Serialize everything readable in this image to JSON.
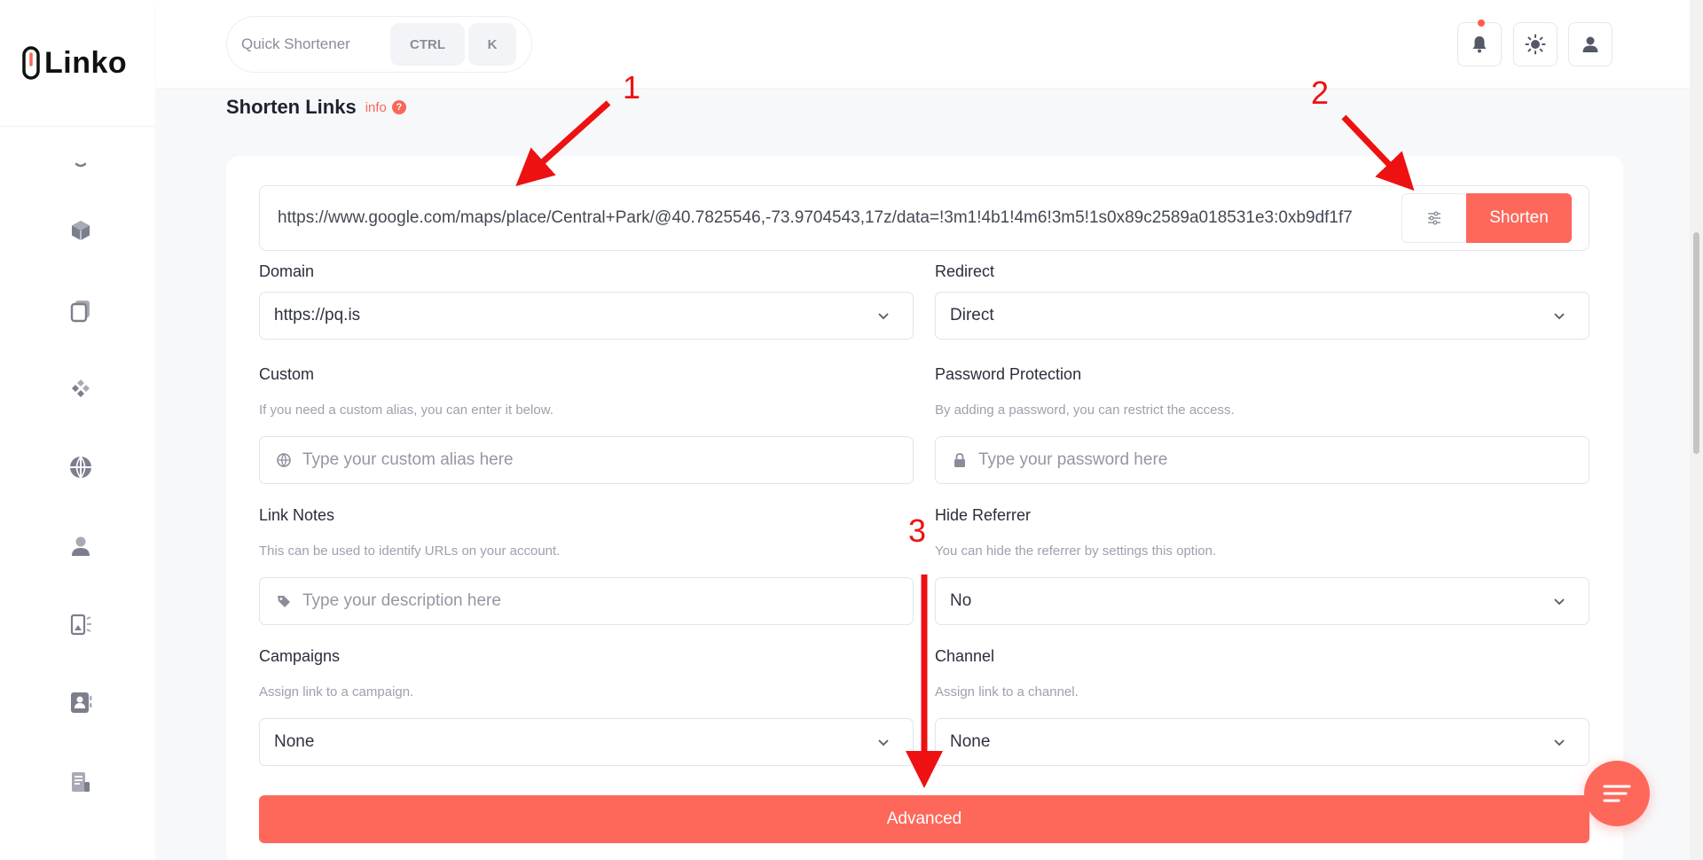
{
  "app": {
    "logo_text": "Linko"
  },
  "topbar": {
    "quick_label": "Quick Shortener",
    "kbd_ctrl": "CTRL",
    "kbd_k": "K",
    "icons": [
      "bell-icon",
      "sun-icon",
      "user-icon"
    ]
  },
  "sidebar": {
    "icons": [
      "partial-icon",
      "cube-icon",
      "copy-icon",
      "diamonds-icon",
      "globe-icon",
      "user-icon",
      "qr-list-icon",
      "contact-card-icon",
      "document-pen-icon"
    ]
  },
  "page": {
    "title": "Shorten Links",
    "info_label": "info",
    "info_q": "?"
  },
  "shortener": {
    "url_value": "https://www.google.com/maps/place/Central+Park/@40.7825546,-73.9704543,17z/data=!3m1!4b1!4m6!3m5!1s0x89c2589a018531e3:0xb9df1f7",
    "shorten_label": "Shorten"
  },
  "form": {
    "domain": {
      "label": "Domain",
      "value": "https://pq.is"
    },
    "redirect": {
      "label": "Redirect",
      "value": "Direct"
    },
    "custom": {
      "label": "Custom",
      "help": "If you need a custom alias, you can enter it below.",
      "placeholder": "Type your custom alias here"
    },
    "password": {
      "label": "Password Protection",
      "help": "By adding a password, you can restrict the access.",
      "placeholder": "Type your password here"
    },
    "notes": {
      "label": "Link Notes",
      "help": "This can be used to identify URLs on your account.",
      "placeholder": "Type your description here"
    },
    "referrer": {
      "label": "Hide Referrer",
      "help": "You can hide the referrer by settings this option.",
      "value": "No"
    },
    "campaigns": {
      "label": "Campaigns",
      "help": "Assign link to a campaign.",
      "value": "None"
    },
    "channel": {
      "label": "Channel",
      "help": "Assign link to a channel.",
      "value": "None"
    },
    "advanced_label": "Advanced"
  },
  "annotations": {
    "n1": "1",
    "n2": "2",
    "n3": "3",
    "color": "#ee1111"
  },
  "colors": {
    "accent": "#fd685b",
    "text": "#2b2d3b",
    "muted": "#9ea1ad"
  }
}
